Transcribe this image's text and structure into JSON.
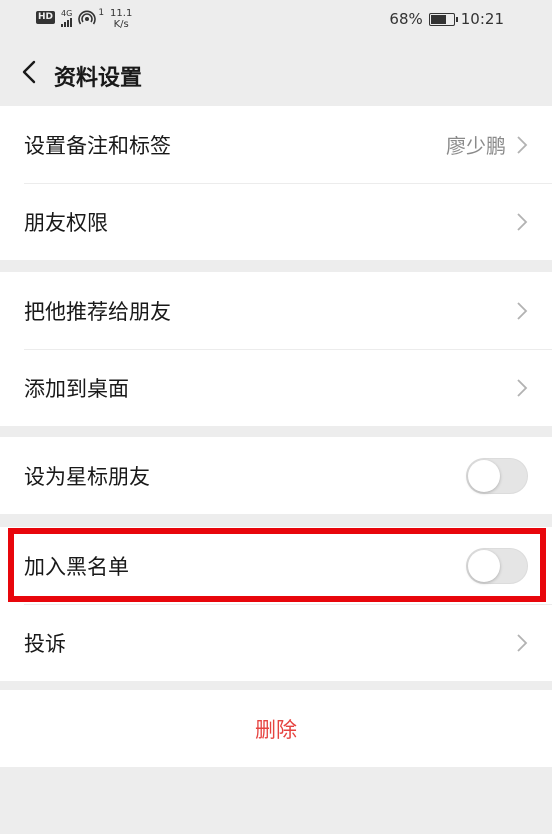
{
  "status_bar": {
    "hd_badge": "HD",
    "network": "4G",
    "hotspot_count": "1",
    "speed_value": "11.1",
    "speed_unit": "K/s",
    "battery_percent": "68%",
    "battery_level": 0.68,
    "time": "10:21"
  },
  "navbar": {
    "title": "资料设置"
  },
  "groups": [
    {
      "rows": [
        {
          "label": "设置备注和标签",
          "value": "廖少鹏",
          "type": "chevron"
        },
        {
          "label": "朋友权限",
          "value": "",
          "type": "chevron"
        }
      ]
    },
    {
      "rows": [
        {
          "label": "把他推荐给朋友",
          "type": "chevron"
        },
        {
          "label": "添加到桌面",
          "type": "chevron"
        }
      ]
    },
    {
      "rows": [
        {
          "label": "设为星标朋友",
          "type": "switch",
          "on": false
        }
      ]
    },
    {
      "rows": [
        {
          "label": "加入黑名单",
          "type": "switch",
          "on": false,
          "highlighted": true
        },
        {
          "label": "投诉",
          "type": "chevron"
        }
      ]
    },
    {
      "rows": [
        {
          "label": "删除",
          "type": "action",
          "color": "#e64340"
        }
      ]
    }
  ],
  "colors": {
    "background": "#ededed",
    "highlight": "#e8060c",
    "delete": "#e64340"
  }
}
